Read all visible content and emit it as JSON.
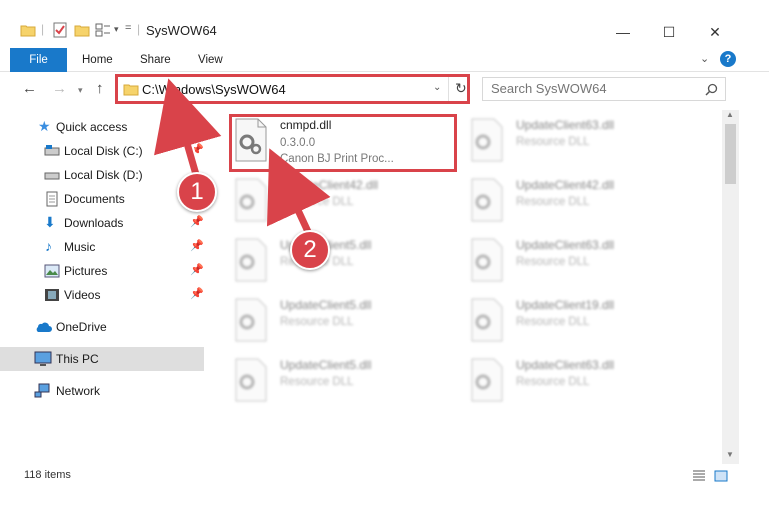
{
  "window": {
    "title": "SysWOW64",
    "minimize": "—",
    "maximize": "☐",
    "close": "✕"
  },
  "ribbon": {
    "file": "File",
    "home": "Home",
    "share": "Share",
    "view": "View",
    "help": "?"
  },
  "address": {
    "path": "C:\\Windows\\SysWOW64",
    "search_placeholder": "Search SysWOW64"
  },
  "nav": {
    "items": [
      {
        "label": "Quick access"
      },
      {
        "label": "Local Disk (C:)"
      },
      {
        "label": "Local Disk (D:)"
      },
      {
        "label": "Documents"
      },
      {
        "label": "Downloads"
      },
      {
        "label": "Music"
      },
      {
        "label": "Pictures"
      },
      {
        "label": "Videos"
      },
      {
        "label": "OneDrive"
      },
      {
        "label": "This PC"
      },
      {
        "label": "Network"
      }
    ]
  },
  "files": {
    "main": {
      "name": "cnmpd.dll",
      "version": "0.3.0.0",
      "description": "Canon BJ Print Proc..."
    },
    "ghosts": [
      {
        "name": "UpdateClient63.dll",
        "type": "Resource DLL"
      },
      {
        "name": "UpdateClient42.dll",
        "type": "Resource DLL"
      },
      {
        "name": "UpdateClient42.dll",
        "type": "Resource DLL"
      },
      {
        "name": "UpdateClient5.dll",
        "type": "Resource DLL"
      },
      {
        "name": "UpdateClient63.dll",
        "type": "Resource DLL"
      },
      {
        "name": "UpdateClient5.dll",
        "type": "Resource DLL"
      },
      {
        "name": "UpdateClient19.dll",
        "type": "Resource DLL"
      },
      {
        "name": "UpdateClient5.dll",
        "type": "Resource DLL"
      },
      {
        "name": "UpdateClient63.dll",
        "type": "Resource DLL"
      }
    ]
  },
  "status": {
    "count": "118 items"
  },
  "callouts": {
    "one": "1",
    "two": "2"
  },
  "colors": {
    "accent": "#1979ca",
    "highlight": "#d9434a"
  }
}
